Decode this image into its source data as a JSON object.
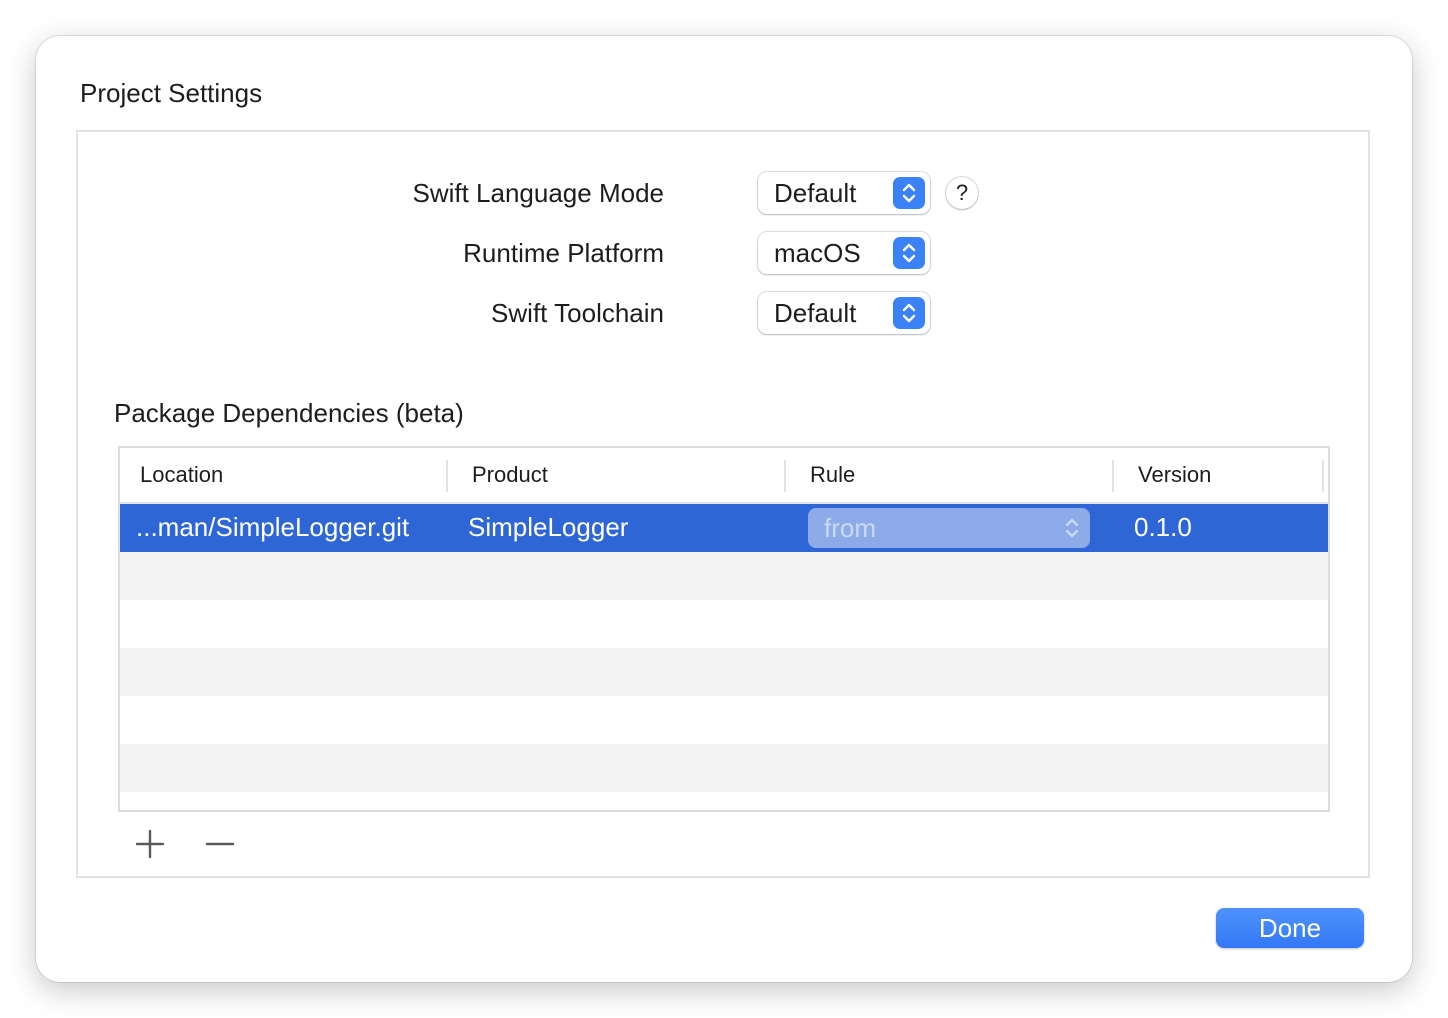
{
  "dialog": {
    "title": "Project Settings"
  },
  "settings": {
    "swift_language_mode": {
      "label": "Swift Language Mode",
      "value": "Default",
      "help": "?"
    },
    "runtime_platform": {
      "label": "Runtime Platform",
      "value": "macOS"
    },
    "swift_toolchain": {
      "label": "Swift Toolchain",
      "value": "Default"
    }
  },
  "dependencies": {
    "title": "Package Dependencies (beta)",
    "columns": [
      "Location",
      "Product",
      "Rule",
      "Version"
    ],
    "rows": [
      {
        "location": "...man/SimpleLogger.git",
        "product": "SimpleLogger",
        "rule": "from",
        "version": "0.1.0",
        "selected": true
      }
    ],
    "add_icon": "plus-icon",
    "remove_icon": "minus-icon"
  },
  "footer": {
    "done_label": "Done"
  },
  "colors": {
    "accent": "#3b82f6",
    "selection": "#2f66d6",
    "stripe": "#f4f4f4"
  }
}
